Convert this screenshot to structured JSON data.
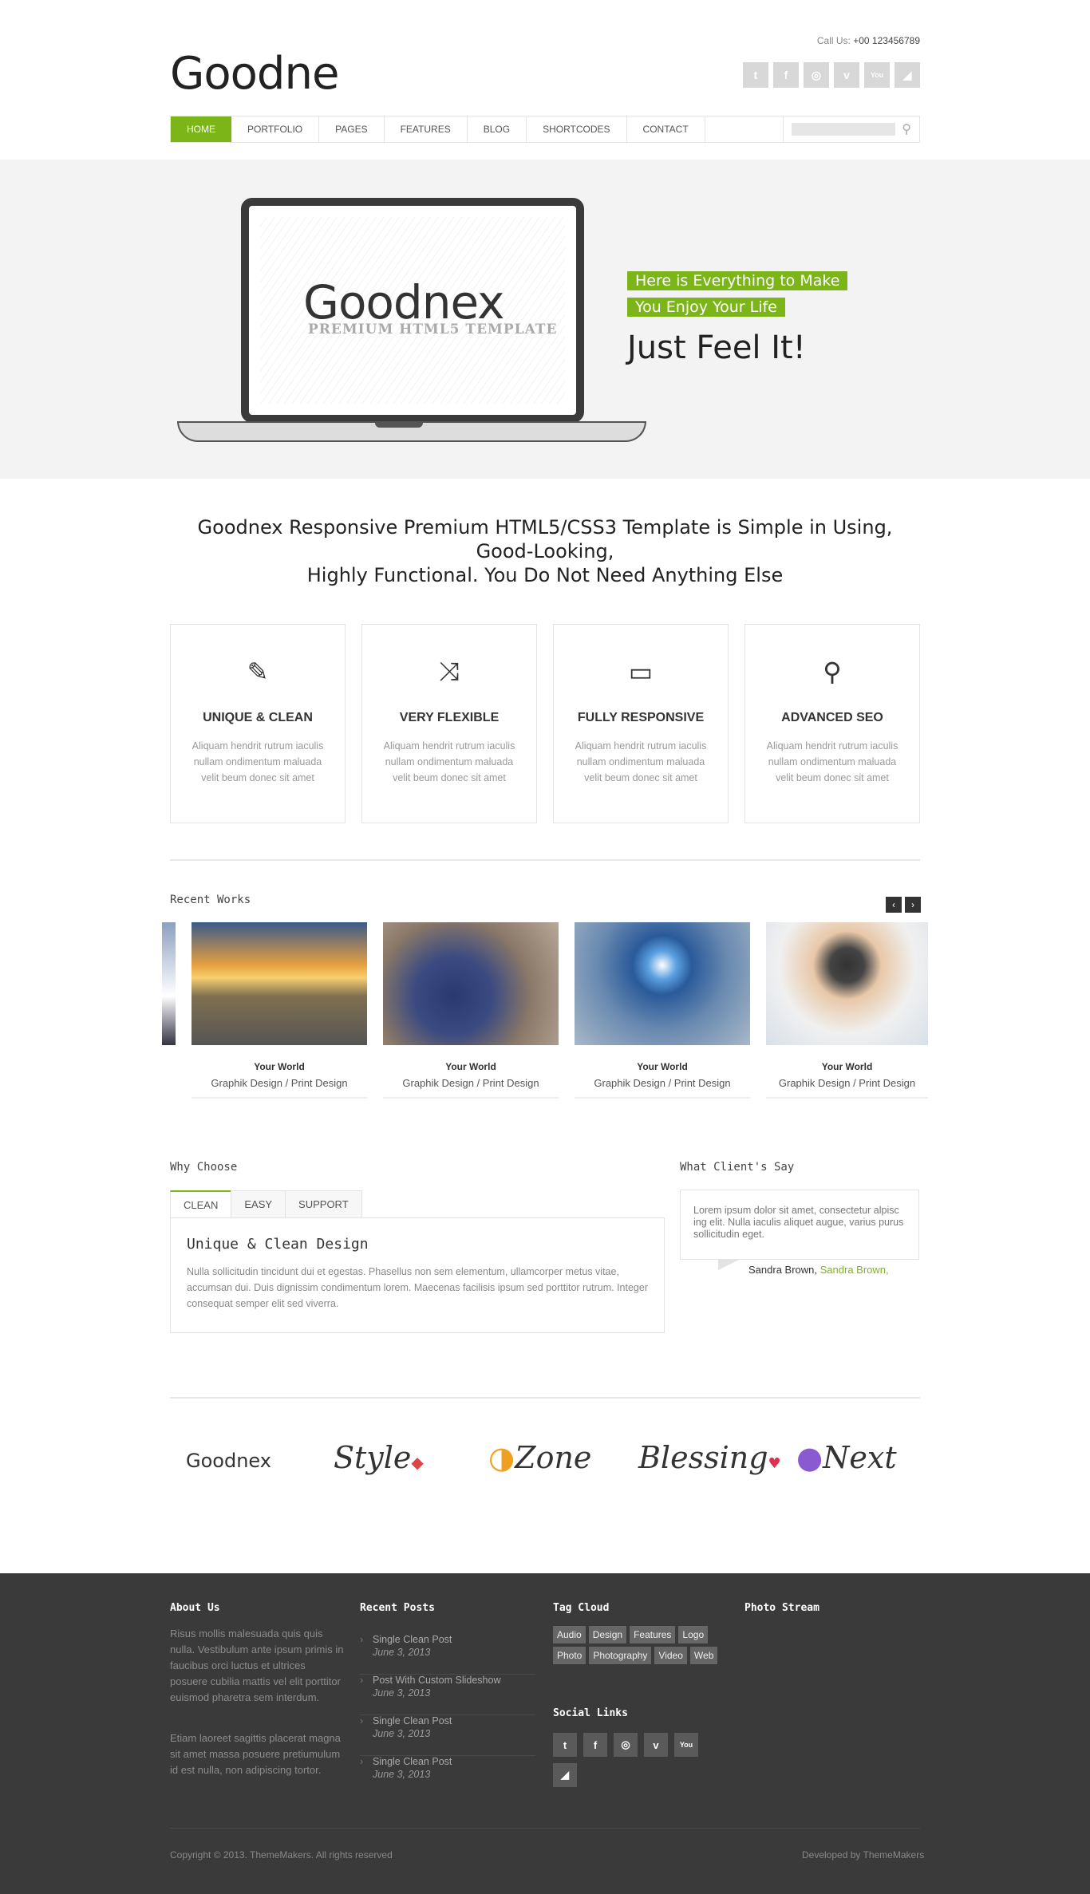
{
  "header": {
    "logo": "Goodne",
    "call_label": "Call Us:",
    "call_number": "+00 123456789",
    "socials": [
      "twitter-icon",
      "facebook-icon",
      "dribbble-icon",
      "vimeo-icon",
      "youtube-icon",
      "rss-icon"
    ]
  },
  "nav": {
    "items": [
      "HOME",
      "PORTFOLIO",
      "PAGES",
      "FEATURES",
      "BLOG",
      "SHORTCODES",
      "CONTACT"
    ],
    "search_placeholder": ""
  },
  "hero": {
    "screen_logo": "Goodnex",
    "screen_sub": "PREMIUM HTML5 TEMPLATE",
    "tag1": "Here is Everything to Make",
    "tag2": "You Enjoy Your Life",
    "headline": "Just Feel It!"
  },
  "intro": {
    "line1": "Goodnex Responsive Premium HTML5/CSS3 Template is Simple in Using, Good-Looking,",
    "line2": "Highly Functional. You Do Not Need Anything Else"
  },
  "features": [
    {
      "title": "UNIQUE & CLEAN",
      "text": "Aliquam hendrit rutrum iaculis nullam ondimentum maluada velit beum donec sit amet"
    },
    {
      "title": "VERY FLEXIBLE",
      "text": "Aliquam hendrit rutrum iaculis nullam ondimentum maluada velit beum donec sit amet"
    },
    {
      "title": "FULLY RESPONSIVE",
      "text": "Aliquam hendrit rutrum iaculis nullam ondimentum maluada velit beum donec sit amet"
    },
    {
      "title": "ADVANCED SEO",
      "text": "Aliquam hendrit rutrum iaculis nullam ondimentum maluada velit beum donec sit amet"
    }
  ],
  "works": {
    "title": "Recent Works",
    "items": [
      {
        "title": "Your World",
        "sub": "Graphik Design / Print Design"
      },
      {
        "title": "Your World",
        "sub": "Graphik Design / Print Design"
      },
      {
        "title": "Your World",
        "sub": "Graphik Design / Print Design"
      },
      {
        "title": "Your World",
        "sub": "Graphik Design / Print Design"
      }
    ]
  },
  "why": {
    "title": "Why Choose",
    "tabs": [
      "CLEAN",
      "EASY",
      "SUPPORT"
    ],
    "heading": "Unique & Clean Design",
    "text": "Nulla sollicitudin tincidunt dui et egestas. Phasellus non sem elementum, ullamcorper metus vitae, accumsan dui. Duis dignissim condimentum lorem. Maecenas facilisis ipsum sed porttitor rutrum. Integer consequat semper elit sed viverra."
  },
  "clients_say": {
    "title": "What Client's Say",
    "quote": "Lorem ipsum dolor sit amet, consectetur alpisc ing elit. Nulla iaculis aliquet augue, varius purus sollicitudin eget.",
    "name": "Sandra Brown,",
    "link": "Sandra Brown,"
  },
  "client_logos": [
    "Goodnex",
    "Style",
    "Zone",
    "Blessing",
    "Next"
  ],
  "footer": {
    "about_title": "About Us",
    "about_p1": "Risus mollis malesuada quis quis nulla. Vestibulum ante ipsum primis in faucibus orci luctus et ultrices posuere cubilia mattis vel elit porttitor euismod pharetra sem interdum.",
    "about_p2": "Etiam laoreet sagittis placerat magna sit amet massa posuere pretiumulum id est nulla, non adipiscing tortor.",
    "posts_title": "Recent Posts",
    "posts": [
      {
        "title": "Single Clean Post",
        "date": "June 3, 2013"
      },
      {
        "title": "Post With Custom Slideshow",
        "date": "June 3, 2013"
      },
      {
        "title": "Single Clean Post",
        "date": "June 3, 2013"
      },
      {
        "title": "Single Clean Post",
        "date": "June 3, 2013"
      }
    ],
    "tags_title": "Tag Cloud",
    "tags": [
      "Audio",
      "Design",
      "Features",
      "Logo",
      "Photo",
      "Photography",
      "Video",
      "Web"
    ],
    "social_title": "Social Links",
    "photo_title": "Photo Stream",
    "copyright": "Copyright © 2013. ThemeMakers. All rights reserved",
    "developed": "Developed by ThemeMakers"
  }
}
